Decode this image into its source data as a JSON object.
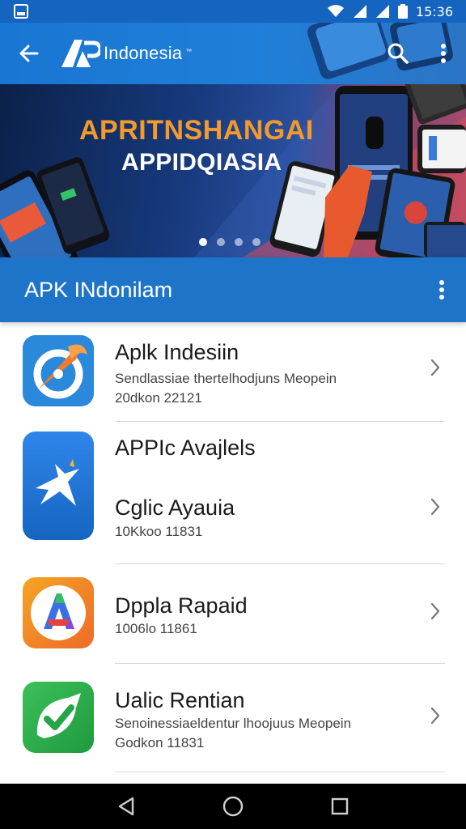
{
  "status_bar": {
    "time": "15:36"
  },
  "app_bar": {
    "title": "Indonesia",
    "trademark": "™",
    "brand_color": "#1976d2"
  },
  "banner": {
    "headline": "APRITNSHANGAI",
    "subheadline": "APPIDQIASIA",
    "slide_count": 4,
    "active_slide": 1
  },
  "section": {
    "title": "APK INdonilam",
    "header_color": "#1e74c9"
  },
  "apps": [
    {
      "name": "Aplk Indesiin",
      "description": "Sendlassiae thertelhodjuns Meopein",
      "meta": "20dkon 22121",
      "icon": "compass-icon"
    },
    {
      "name": "APPIc Avajlels",
      "subtitle": "Cglic Ayauia",
      "meta": "10Kkoo 11831",
      "icon": "star-plane-icon"
    },
    {
      "name": "Dppla Rapaid",
      "meta": "1006lo 11861",
      "icon": "letter-a-icon"
    },
    {
      "name": "Ualic Rentian",
      "description": "Senoinessiaeldentur lhoojuus Meopein",
      "meta": "Godkon 11831",
      "icon": "checkmark-icon"
    }
  ],
  "nav": {
    "back": "back-triangle-icon",
    "home": "home-circle-icon",
    "recents": "recents-square-icon"
  }
}
